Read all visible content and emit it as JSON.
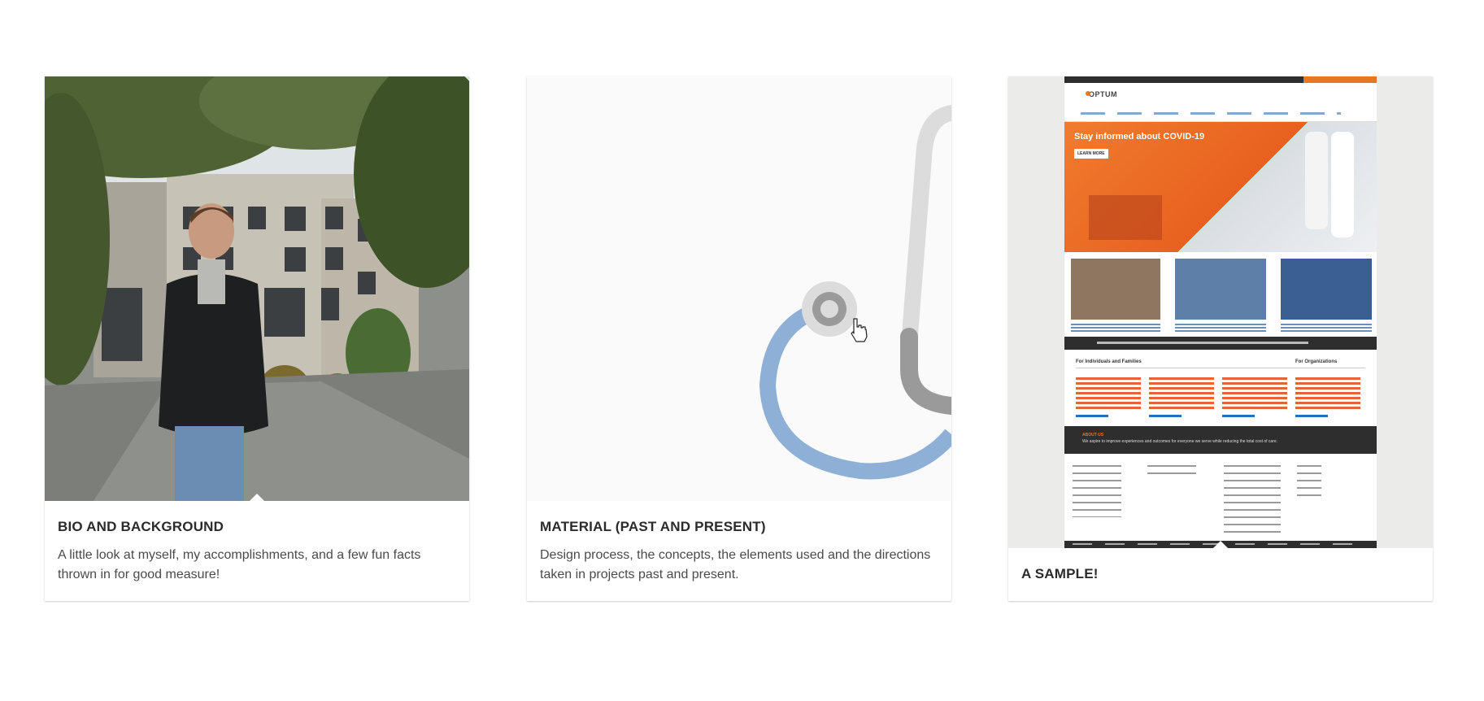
{
  "cards": [
    {
      "title": "BIO AND BACKGROUND",
      "description": "A little look at myself, my accomplishments, and a few fun facts thrown in for good measure!"
    },
    {
      "title": "MATERIAL (PAST AND PRESENT)",
      "description": "Design process, the concepts, the elements used and the directions taken in projects past and present."
    },
    {
      "title": "A SAMPLE!"
    }
  ],
  "sample_site": {
    "logo": "OPTUM",
    "hero_heading": "Stay informed about COVID-19",
    "hero_button": "LEARN MORE",
    "section_individuals": "For Individuals and Families",
    "section_organizations": "For Organizations",
    "about_heading": "ABOUT US",
    "about_text": "We aspire to improve experiences and outcomes for everyone we serve while reducing the total cost of care.",
    "colors": {
      "brand_orange": "#e87722",
      "dark_bar": "#2e2e2e",
      "link_blue": "#2a6ebb"
    }
  },
  "stethoscope_colors": {
    "tube_blue": "#8fb0d6",
    "gray_light": "#dcdcdc",
    "gray_dark": "#9a9a9a"
  }
}
